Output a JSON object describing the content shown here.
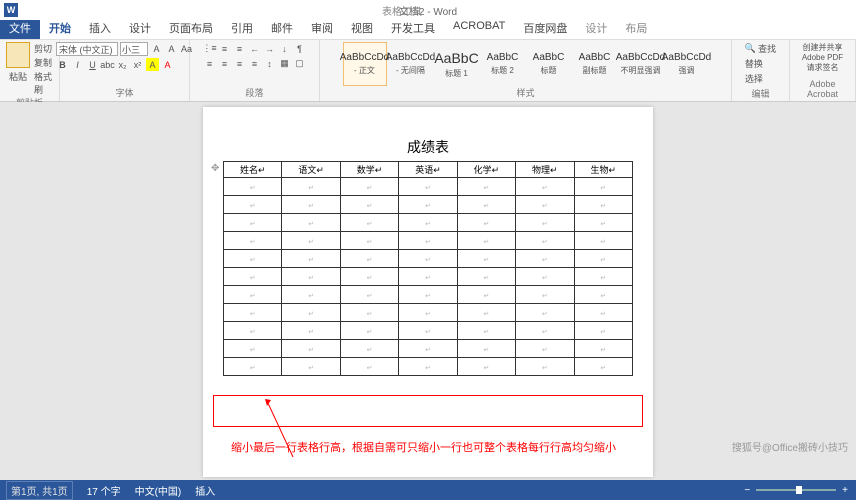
{
  "titlebar": {
    "title": "文档2 - Word",
    "tools": "表格工具"
  },
  "tabs": {
    "file": "文件",
    "items": [
      "开始",
      "插入",
      "设计",
      "页面布局",
      "引用",
      "邮件",
      "审阅",
      "视图",
      "开发工具",
      "ACROBAT",
      "百度网盘",
      "设计",
      "布局"
    ],
    "active": 0,
    "ctx_start": 11
  },
  "ribbon": {
    "clipboard": {
      "cut": "剪切",
      "copy": "复制",
      "brush": "格式刷",
      "paste": "粘贴",
      "label": "剪贴板"
    },
    "font": {
      "family": "宋体 (中文正)",
      "size": "小三",
      "label": "字体"
    },
    "paragraph": {
      "label": "段落"
    },
    "styles": {
      "items": [
        {
          "prev": "AaBbCcDd",
          "name": "- 正文",
          "sel": true
        },
        {
          "prev": "AaBbCcDd",
          "name": "- 无间隔"
        },
        {
          "prev": "AaBbC",
          "name": "标题 1",
          "big": true
        },
        {
          "prev": "AaBbC",
          "name": "标题 2"
        },
        {
          "prev": "AaBbC",
          "name": "标题"
        },
        {
          "prev": "AaBbC",
          "name": "副标题"
        },
        {
          "prev": "AaBbCcDd",
          "name": "不明显强调"
        },
        {
          "prev": "AaBbCcDd",
          "name": "强调"
        }
      ],
      "label": "样式"
    },
    "editing": {
      "find": "查找",
      "replace": "替换",
      "select": "选择",
      "label": "编辑"
    },
    "adobe": {
      "line1": "创建并共享",
      "line2": "Adobe PDF",
      "line3": "请求签名",
      "label": "Adobe Acrobat"
    }
  },
  "doc": {
    "title": "成绩表",
    "headers": [
      "姓名",
      "语文",
      "数学",
      "英语",
      "化学",
      "物理",
      "生物"
    ],
    "rows": 11,
    "annotation": "缩小最后一行表格行高，根据自需可只缩小一行也可整个表格每行行高均匀缩小"
  },
  "watermark": "搜狐号@Office搬砖小技巧",
  "status": {
    "page": "第1页, 共1页",
    "words": "17 个字",
    "lang": "中文(中国)",
    "ins": "插入"
  }
}
